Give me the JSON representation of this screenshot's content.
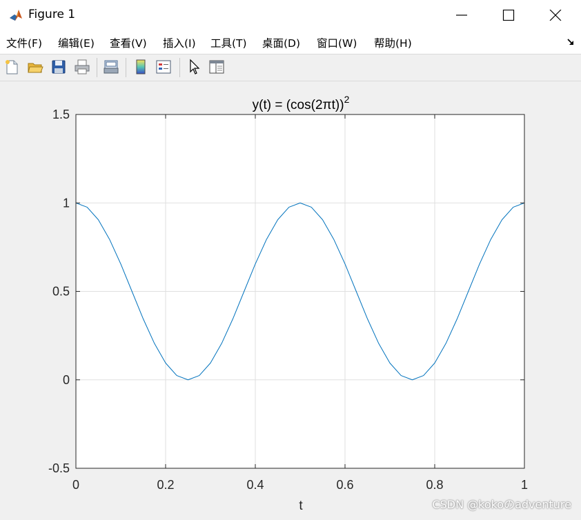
{
  "window": {
    "title": "Figure 1",
    "controls": [
      "minimize",
      "maximize",
      "close"
    ]
  },
  "menu": {
    "items": [
      "文件(F)",
      "编辑(E)",
      "查看(V)",
      "插入(I)",
      "工具(T)",
      "桌面(D)",
      "窗口(W)",
      "帮助(H)"
    ]
  },
  "toolbar": {
    "buttons": [
      "new-figure-icon",
      "open-file-icon",
      "save-icon",
      "print-icon",
      "print-preview-icon",
      "colorbar-icon",
      "legend-icon",
      "pointer-icon",
      "property-inspector-icon"
    ]
  },
  "chart_data": {
    "type": "line",
    "title": "y(t) = (cos(2πt))",
    "title_superscript": "2",
    "xlabel": "t",
    "ylabel": "",
    "xlim": [
      0,
      1
    ],
    "ylim": [
      -0.5,
      1.5
    ],
    "xticks": [
      "0",
      "0.2",
      "0.4",
      "0.6",
      "0.8",
      "1"
    ],
    "yticks": [
      "-0.5",
      "0",
      "0.5",
      "1",
      "1.5"
    ],
    "grid": true,
    "series": [
      {
        "color": "#0072bd",
        "x": [
          0,
          0.025,
          0.05,
          0.075,
          0.1,
          0.125,
          0.15,
          0.175,
          0.2,
          0.225,
          0.25,
          0.275,
          0.3,
          0.325,
          0.35,
          0.375,
          0.4,
          0.425,
          0.45,
          0.475,
          0.5,
          0.525,
          0.55,
          0.575,
          0.6,
          0.625,
          0.65,
          0.675,
          0.7,
          0.725,
          0.75,
          0.775,
          0.8,
          0.825,
          0.85,
          0.875,
          0.9,
          0.925,
          0.95,
          0.975,
          1
        ],
        "y": [
          1,
          0.976,
          0.905,
          0.794,
          0.655,
          0.5,
          0.345,
          0.206,
          0.095,
          0.024,
          0,
          0.024,
          0.095,
          0.206,
          0.345,
          0.5,
          0.655,
          0.794,
          0.905,
          0.976,
          1,
          0.976,
          0.905,
          0.794,
          0.655,
          0.5,
          0.345,
          0.206,
          0.095,
          0.024,
          0,
          0.024,
          0.095,
          0.206,
          0.345,
          0.5,
          0.655,
          0.794,
          0.905,
          0.976,
          1
        ]
      }
    ]
  },
  "watermark": "CSDN @kokoのadventure"
}
